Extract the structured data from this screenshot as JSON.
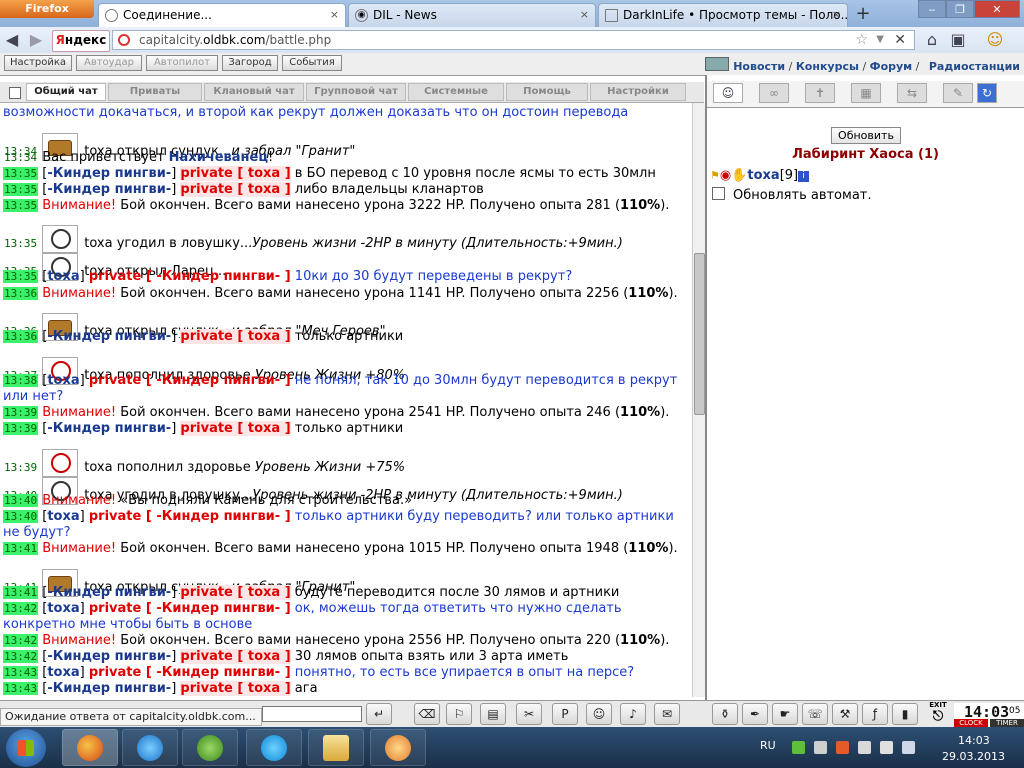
{
  "browser": {
    "menu_button": "Firefox",
    "tabs": [
      {
        "title": "Соединение...",
        "icon": "loading-icon",
        "close": "×"
      },
      {
        "title": "DIL - News",
        "icon": "dil-icon",
        "close": "×"
      },
      {
        "title": "DarkInLife • Просмотр темы - Поло...",
        "icon": "page-icon",
        "close": "×"
      }
    ],
    "new_tab": "+",
    "search_engine": {
      "prefix": "Я",
      "rest": "ндекс"
    },
    "url_host": "capitalcity.",
    "url_domain": "oldbk.com",
    "url_path": "/battle.php"
  },
  "game_toolbar": {
    "buttons": [
      "Настройка",
      "Автоудар",
      "Автопилот",
      "Загород",
      "События"
    ],
    "links": [
      "Новости",
      "Конкурсы",
      "Форум",
      "Радиостанции"
    ]
  },
  "chat_tabs": [
    "Общий чат",
    "Приваты",
    "Клановый чат",
    "Групповой чат",
    "Системные",
    "Помощь",
    "Настройки"
  ],
  "chat_top_line": "возможности докачаться, и второй как рекрут должен доказать что он достоин перевода",
  "chat_lines": [
    {
      "time": "13:34",
      "actor": "toxa открыл сундук...",
      "italic": "и забрал \"Гранит\""
    },
    {
      "time": "13:34",
      "text": "Вас приветствует ",
      "nick": "Нахичеванец",
      "tail": "!"
    },
    {
      "time": "13:35",
      "from": "-Киндер пингви-",
      "priv": "private [ toxa ]",
      "msg": "в БО перевод с 10 уровня после ясмы то есть 30млн"
    },
    {
      "time": "13:35",
      "from": "-Киндер пингви-",
      "priv": "private [ toxa ]",
      "msg": "либо владельцы кланартов"
    },
    {
      "time": "13:35",
      "warn": "Внимание!",
      "msg": " Бой окончен. Всего вами нанесено урона 3222 HP. Получено опыта 281 (",
      "bold": "110%",
      "tail": ")."
    },
    {
      "time": "13:35",
      "actor": "toxa угодил в ловушку...",
      "italic": "Уровень жизни -2HP в минуту (Длительность:+9мин.)"
    },
    {
      "time": "13:35",
      "actor": "toxa открыл Ларец..."
    },
    {
      "time": "13:35",
      "from": "toxa",
      "priv": "private [ -Киндер пингви- ]",
      "msg": "10ки до 30 будут переведены в рекрут?"
    },
    {
      "time": "13:36",
      "warn": "Внимание!",
      "msg": " Бой окончен. Всего вами нанесено урона 1141 HP. Получено опыта 2256 (",
      "bold": "110%",
      "tail": ")."
    },
    {
      "time": "13:36",
      "actor": "toxa открыл сундук...",
      "italic": "и забрал \"Меч Героев\""
    },
    {
      "time": "13:36",
      "from": "-Киндер пингви-",
      "priv": "private [ toxa ]",
      "msg": "только артники"
    },
    {
      "time": "13:37",
      "actor": "toxa пополнил здоровье ",
      "italic": "Уровень Жизни +80%"
    },
    {
      "time": "13:38",
      "from": "toxa",
      "priv": "private [ -Киндер пингви- ]",
      "msg": "не понял, так 10 до 30млн будут переводится в рекрут",
      "msg2": "или нет?"
    },
    {
      "time": "13:39",
      "warn": "Внимание!",
      "msg": " Бой окончен. Всего вами нанесено урона 2541 HP. Получено опыта 246 (",
      "bold": "110%",
      "tail": ")."
    },
    {
      "time": "13:39",
      "from": "-Киндер пингви-",
      "priv": "private [ toxa ]",
      "msg": "только артники"
    },
    {
      "time": "13:39",
      "actor": "toxa пополнил здоровье ",
      "italic": "Уровень Жизни +75%"
    },
    {
      "time": "13:40",
      "actor": "toxa угодил в ловушку...",
      "italic": "Уровень жизни -2HP в минуту (Длительность:+9мин.)"
    },
    {
      "time": "13:40",
      "warn": "Внимание!",
      "msg": " «Вы подняли Камень для строительства.»"
    },
    {
      "time": "13:40",
      "from": "toxa",
      "priv": "private [ -Киндер пингви- ]",
      "msg": "только артники буду переводить? или только артники",
      "msg2": "не будут?"
    },
    {
      "time": "13:41",
      "warn": "Внимание!",
      "msg": " Бой окончен. Всего вами нанесено урона 1015 HP. Получено опыта 1948 (",
      "bold": "110%",
      "tail": ")."
    },
    {
      "time": "13:41",
      "actor": "toxa открыл сундук...",
      "italic": "и забрал \"Гранит\""
    },
    {
      "time": "13:41",
      "from": "-Киндер пингви-",
      "priv": "private [ toxa ]",
      "msg": "будуте переводится после 30 лямов и артники"
    },
    {
      "time": "13:42",
      "from": "toxa",
      "priv": "private [ -Киндер пингви- ]",
      "msg": "ок, можешь тогда ответить что нужно сделать",
      "msg2": "конкретно мне чтобы быть в основе"
    },
    {
      "time": "13:42",
      "warn": "Внимание!",
      "msg": " Бой окончен. Всего вами нанесено урона 2556 HP. Получено опыта 220 (",
      "bold": "110%",
      "tail": ")."
    },
    {
      "time": "13:42",
      "from": "-Киндер пингви-",
      "priv": "private [ toxa ]",
      "msg": "30 лямов опыта взять или 3 арта иметь"
    },
    {
      "time": "13:43",
      "from": "toxa",
      "priv": "private [ -Киндер пингви- ]",
      "msg": "понятно, то есть все упирается в опыт на персе?"
    },
    {
      "time": "13:43",
      "from": "-Киндер пингви-",
      "priv": "private [ toxa ]",
      "msg": "ага"
    }
  ],
  "right_panel": {
    "refresh_button": "Обновить",
    "location": "Лабиринт Хаоса (1)",
    "player_name": "toxa",
    "player_level": "[9]",
    "auto_refresh": "Обновлять автомат."
  },
  "status_bar": "Ожидание ответа от capitalcity.oldbk.com...",
  "game_clock": {
    "time": "14:03",
    "seconds": "05",
    "label_clock": "CLOCK",
    "label_timer": "TIMER",
    "exit": "EXIT"
  },
  "taskbar": {
    "lang": "RU",
    "time": "14:03",
    "date": "29.03.2013"
  },
  "colors": {
    "accent_timestamp": "#3bf06a",
    "private_red": "#e00000",
    "nick_blue": "#1a3a8e",
    "location_red": "#8b0000"
  }
}
